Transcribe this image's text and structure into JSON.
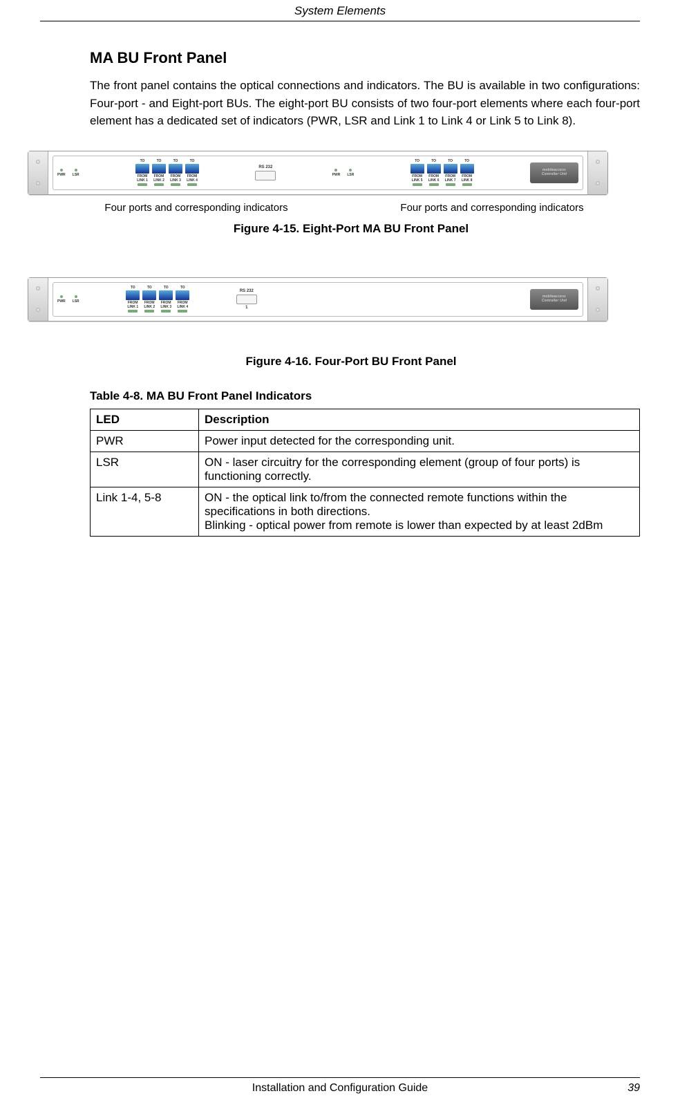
{
  "header": {
    "title": "System Elements"
  },
  "section": {
    "heading": "MA BU Front Panel",
    "paragraph": "The front panel contains the optical connections and indicators. The BU is available in two configurations: Four-port - and Eight-port BUs. The eight-port BU consists of two four-port elements where each four-port element has a dedicated set of indicators (PWR, LSR and Link 1 to Link 4 or Link 5 to Link 8)."
  },
  "panel_labels": {
    "pwr": "PWR",
    "lsr": "LSR",
    "to": "TO",
    "from": "FROM",
    "rs232": "RS 232",
    "brand_line1": "mobileaccess",
    "brand_line2": "Controller Unit"
  },
  "panel8": {
    "links_left": [
      "LINK 1",
      "LINK 2",
      "LINK 3",
      "LINK 4"
    ],
    "links_right": [
      "LINK 5",
      "LINK 6",
      "LINK 7",
      "LINK 8"
    ]
  },
  "panel4": {
    "links": [
      "LINK 1",
      "LINK 2",
      "LINK 3",
      "LINK 4"
    ],
    "right_label": "1"
  },
  "captions": {
    "left": "Four ports and corresponding indicators",
    "right": "Four ports and corresponding indicators"
  },
  "figures": {
    "fig15": "Figure 4-15. Eight-Port MA BU Front Panel",
    "fig16": "Figure 4-16. Four-Port BU Front Panel"
  },
  "table": {
    "caption": "Table 4-8. MA BU Front Panel Indicators",
    "headers": {
      "col1": "LED",
      "col2": "Description"
    },
    "rows": [
      {
        "led": "PWR",
        "desc": "Power input detected for the corresponding unit."
      },
      {
        "led": "LSR",
        "desc": "ON - laser circuitry for the corresponding element (group of four ports) is functioning correctly."
      },
      {
        "led": "Link 1-4, 5-8",
        "desc": "ON - the optical link to/from the connected remote functions within the specifications in both directions.\nBlinking - optical power from remote is lower than expected by at least 2dBm"
      }
    ]
  },
  "footer": {
    "center": "Installation and Configuration Guide",
    "page": "39"
  }
}
